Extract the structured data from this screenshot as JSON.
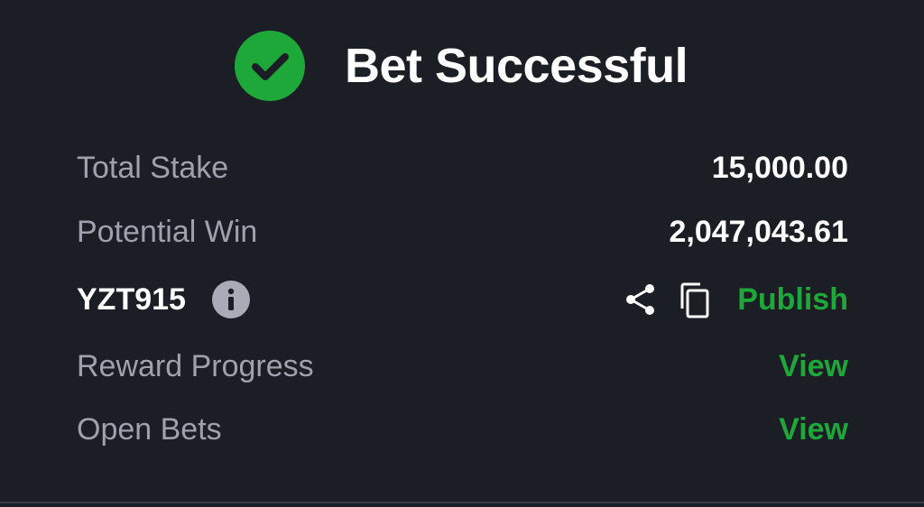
{
  "header": {
    "title": "Bet Successful",
    "icon": "check-circle-icon",
    "accent_color": "#1fa83a"
  },
  "details": {
    "total_stake_label": "Total Stake",
    "total_stake_value": "15,000.00",
    "potential_win_label": "Potential Win",
    "potential_win_value": "2,047,043.61",
    "booking_code": "YZT915",
    "publish_label": "Publish",
    "reward_progress_label": "Reward Progress",
    "reward_progress_action": "View",
    "open_bets_label": "Open Bets",
    "open_bets_action": "View"
  },
  "icons": {
    "info": "info-icon",
    "share": "share-icon",
    "copy": "copy-icon"
  }
}
